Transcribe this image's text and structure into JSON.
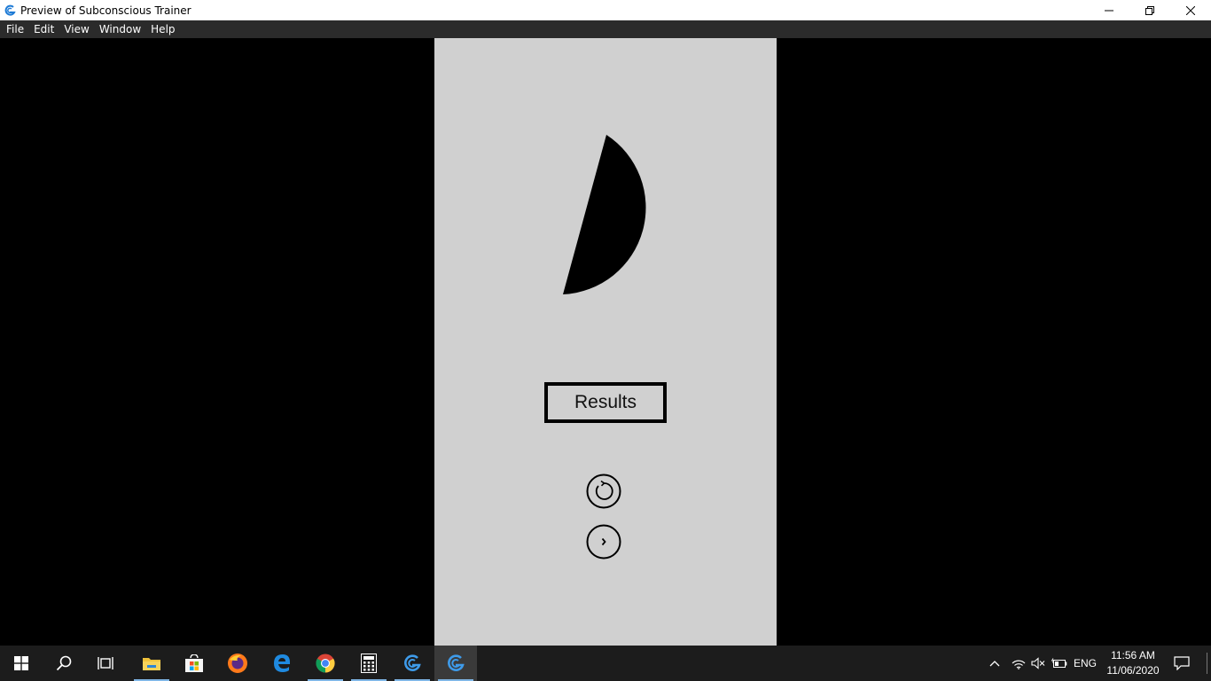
{
  "window": {
    "title": "Preview of Subconscious Trainer",
    "minimize_icon": "minimize-icon",
    "maximize_icon": "restore-icon",
    "close_icon": "close-icon"
  },
  "menu": {
    "items": [
      "File",
      "Edit",
      "View",
      "Window",
      "Help"
    ]
  },
  "app": {
    "shape": "half-disc-shape",
    "results_label": "Results",
    "retry_icon": "refresh-icon",
    "next_icon": "chevron-right-icon",
    "colors": {
      "background": "#d0d0d0",
      "shape": "#000000",
      "outer": "#000000"
    }
  },
  "taskbar": {
    "pinned": [
      "windows-start-icon",
      "search-icon",
      "task-view-icon",
      "file-explorer-icon",
      "microsoft-store-icon",
      "firefox-icon",
      "edge-icon",
      "chrome-icon",
      "calculator-icon",
      "gdevelop-icon",
      "gdevelop-preview-icon"
    ],
    "language": "ENG",
    "time": "11:56 AM",
    "date": "11/06/2020"
  }
}
